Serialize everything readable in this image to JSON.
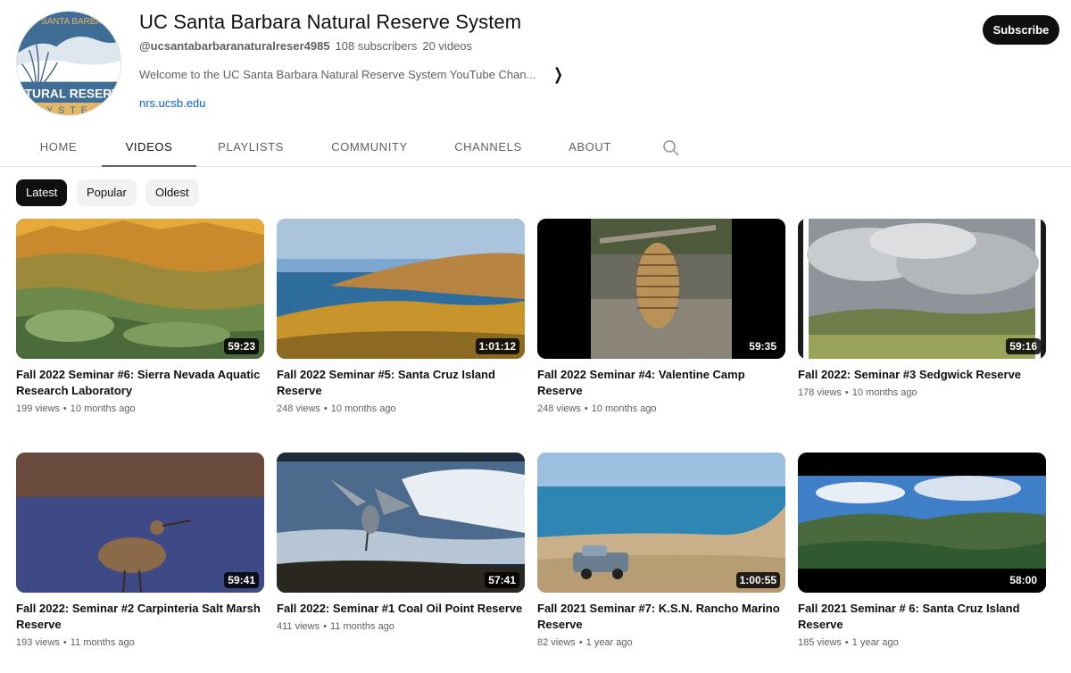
{
  "channel": {
    "name": "UC Santa Barbara Natural Reserve System",
    "handle": "@ucsantabarbaranaturalreser4985",
    "subscribers": "108 subscribers",
    "video_count": "20 videos",
    "description": "Welcome to the UC Santa Barbara Natural Reserve System YouTube Chan...",
    "link": "nrs.ucsb.edu",
    "subscribe_label": "Subscribe",
    "avatar": {
      "logo_text_top": "SANTA BARBA",
      "logo_text_main": "NATURAL RESERVE",
      "logo_text_bottom": "YSTE",
      "icon": "reserve-logo-icon"
    }
  },
  "tabs": [
    {
      "label": "HOME",
      "active": false
    },
    {
      "label": "VIDEOS",
      "active": true
    },
    {
      "label": "PLAYLISTS",
      "active": false
    },
    {
      "label": "COMMUNITY",
      "active": false
    },
    {
      "label": "CHANNELS",
      "active": false
    },
    {
      "label": "ABOUT",
      "active": false
    }
  ],
  "search_icon": "search-icon",
  "chips": [
    {
      "label": "Latest",
      "active": true
    },
    {
      "label": "Popular",
      "active": false
    },
    {
      "label": "Oldest",
      "active": false
    }
  ],
  "videos": [
    {
      "title": "Fall 2022 Seminar #6: Sierra Nevada Aquatic Research Laboratory",
      "duration": "59:23",
      "views": "199 views",
      "age": "10 months ago"
    },
    {
      "title": "Fall 2022 Seminar #5: Santa Cruz Island Reserve",
      "duration": "1:01:12",
      "views": "248 views",
      "age": "10 months ago"
    },
    {
      "title": "Fall 2022 Seminar #4: Valentine Camp Reserve",
      "duration": "59:35",
      "views": "248 views",
      "age": "10 months ago"
    },
    {
      "title": "Fall 2022: Seminar #3 Sedgwick Reserve",
      "duration": "59:16",
      "views": "178 views",
      "age": "10 months ago"
    },
    {
      "title": "Fall 2022: Seminar #2 Carpinteria Salt Marsh Reserve",
      "duration": "59:41",
      "views": "193 views",
      "age": "11 months ago"
    },
    {
      "title": "Fall 2022: Seminar #1 Coal Oil Point Reserve",
      "duration": "57:41",
      "views": "411 views",
      "age": "11 months ago"
    },
    {
      "title": "Fall 2021 Seminar #7: K.S.N. Rancho Marino Reserve",
      "duration": "1:00:55",
      "views": "82 views",
      "age": "1 year ago"
    },
    {
      "title": "Fall 2021 Seminar # 6: Santa Cruz Island Reserve",
      "duration": "58:00",
      "views": "185 views",
      "age": "1 year ago"
    }
  ],
  "stats_separator": "•"
}
